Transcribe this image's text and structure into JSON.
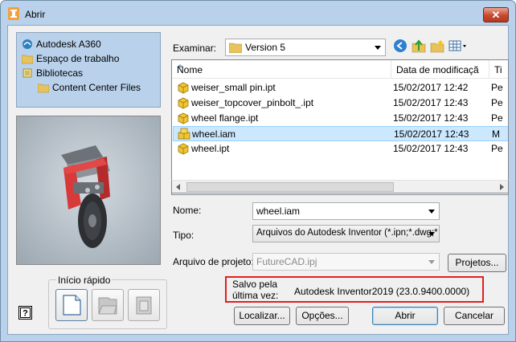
{
  "window": {
    "title": "Abrir",
    "close_label": "✕"
  },
  "places": [
    {
      "label": "Autodesk A360",
      "icon": "a360-icon"
    },
    {
      "label": "Espaço de trabalho",
      "icon": "folder-icon"
    },
    {
      "label": "Bibliotecas",
      "icon": "library-icon"
    },
    {
      "label": "Content Center Files",
      "icon": "folder-icon"
    }
  ],
  "examinar": {
    "label": "Examinar:",
    "value": "Version 5"
  },
  "file_list": {
    "columns": [
      "Nome",
      "Data de modificaçã",
      "Ti"
    ],
    "rows": [
      {
        "name": "weiser_small pin.ipt",
        "date": "15/02/2017 12:42",
        "type": "Pe",
        "kind": "ipt",
        "selected": false
      },
      {
        "name": "weiser_topcover_pinbolt_.ipt",
        "date": "15/02/2017 12:43",
        "type": "Pe",
        "kind": "ipt",
        "selected": false
      },
      {
        "name": "wheel flange.ipt",
        "date": "15/02/2017 12:43",
        "type": "Pe",
        "kind": "ipt",
        "selected": false
      },
      {
        "name": "wheel.iam",
        "date": "15/02/2017 12:43",
        "type": "M",
        "kind": "iam",
        "selected": true
      },
      {
        "name": "wheel.ipt",
        "date": "15/02/2017 12:43",
        "type": "Pe",
        "kind": "ipt",
        "selected": false
      }
    ]
  },
  "form": {
    "nome_label": "Nome:",
    "nome_value": "wheel.iam",
    "tipo_label": "Tipo:",
    "tipo_value": "Arquivos do Autodesk Inventor (*.ipn;*.dwg;*",
    "projeto_label": "Arquivo de projeto:",
    "projeto_value": "FutureCAD.ipj",
    "projetos_button": "Projetos..."
  },
  "quick_start": {
    "label": "Início rápido"
  },
  "saved_by": {
    "line1": "Salvo pela",
    "line2": "última vez:",
    "value": "Autodesk Inventor2019 (23.0.9400.0000)"
  },
  "buttons": {
    "localizar": "Localizar...",
    "opcoes": "Opções...",
    "abrir": "Abrir",
    "cancelar": "Cancelar"
  },
  "colors": {
    "titlebar": "#b9d1ea",
    "selection": "#cce8ff",
    "highlight_box": "#e02020"
  }
}
